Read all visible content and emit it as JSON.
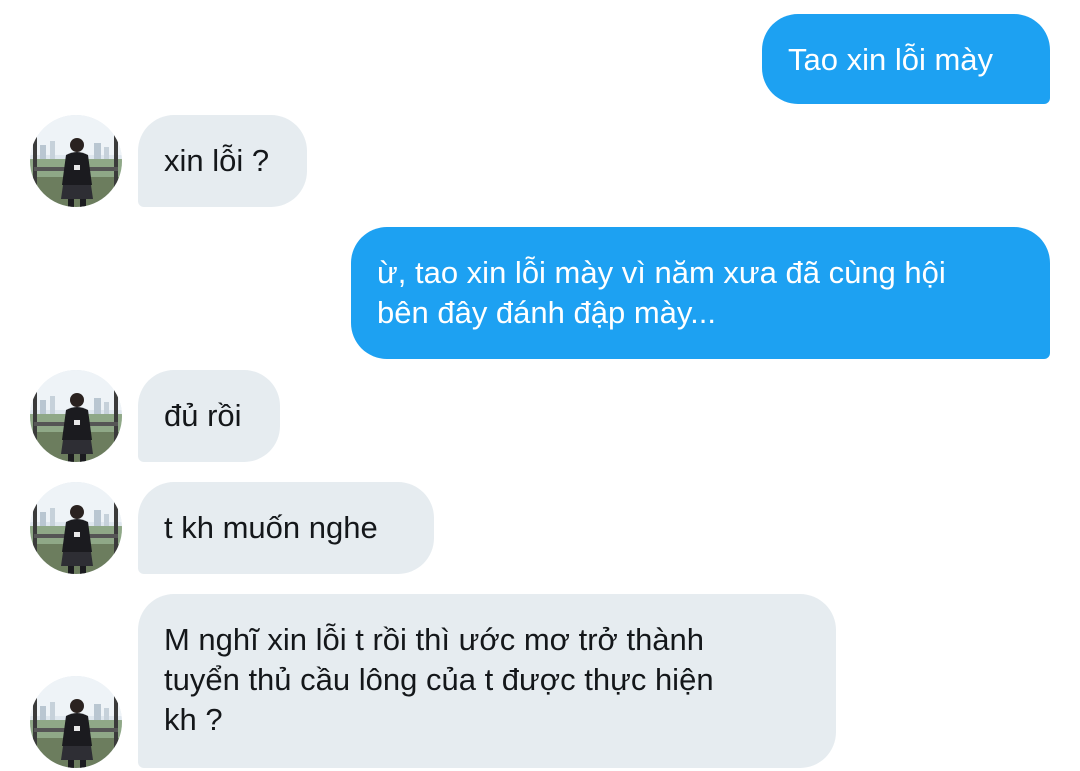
{
  "conversation": {
    "messages": [
      {
        "id": "m1",
        "direction": "outgoing",
        "text": "Tao xin lỗi mày"
      },
      {
        "id": "m2",
        "direction": "incoming",
        "text": "xin lỗi ?"
      },
      {
        "id": "m3",
        "direction": "outgoing",
        "text": "ừ, tao xin lỗi mày vì năm xưa đã cùng hội\nbên đây đánh đập mày..."
      },
      {
        "id": "m4",
        "direction": "incoming",
        "text": "đủ rồi"
      },
      {
        "id": "m5",
        "direction": "incoming",
        "text": "t kh muốn nghe"
      },
      {
        "id": "m6",
        "direction": "incoming",
        "text": "M nghĩ xin lỗi t rồi thì ước mơ trở thành\ntuyển thủ cầu lông của t được thực hiện\nkh ?"
      }
    ]
  },
  "theme": {
    "outgoing_bubble_color": "#1da1f2",
    "incoming_bubble_color": "#e6ecf0",
    "outgoing_text_color": "#ffffff",
    "incoming_text_color": "#14171a"
  },
  "icons": {
    "avatar": "contact-avatar-photo"
  }
}
